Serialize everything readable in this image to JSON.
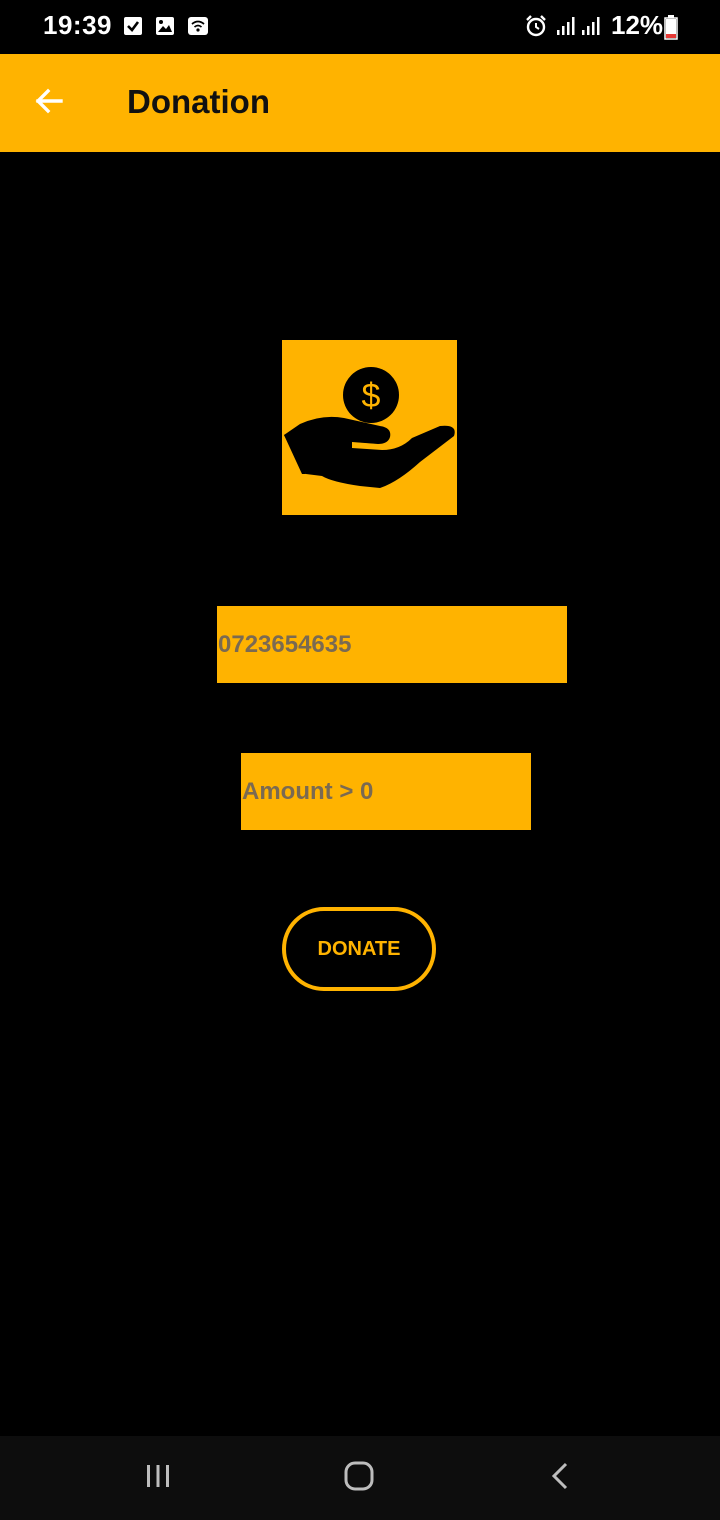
{
  "status_bar": {
    "time": "19:39",
    "battery_percent": "12%",
    "icons": [
      "checkbox-notification-icon",
      "image-notification-icon",
      "wifi-icon",
      "alarm-icon",
      "signal-icon",
      "signal-icon",
      "battery-icon"
    ]
  },
  "app_bar": {
    "title": "Donation",
    "back_icon": "arrow-left-icon"
  },
  "illustration": {
    "icon": "hand-holding-dollar-icon",
    "symbol": "$"
  },
  "form": {
    "phone_value": "0723654635",
    "amount_placeholder": "Amount > 0",
    "donate_label": "DONATE"
  },
  "nav_bar": {
    "icons": [
      "recent-apps-icon",
      "home-icon",
      "back-icon"
    ]
  },
  "colors": {
    "accent": "#FFB300",
    "background": "#000000",
    "field_text": "#7a6a52",
    "nav_background": "#0d0d0d"
  }
}
